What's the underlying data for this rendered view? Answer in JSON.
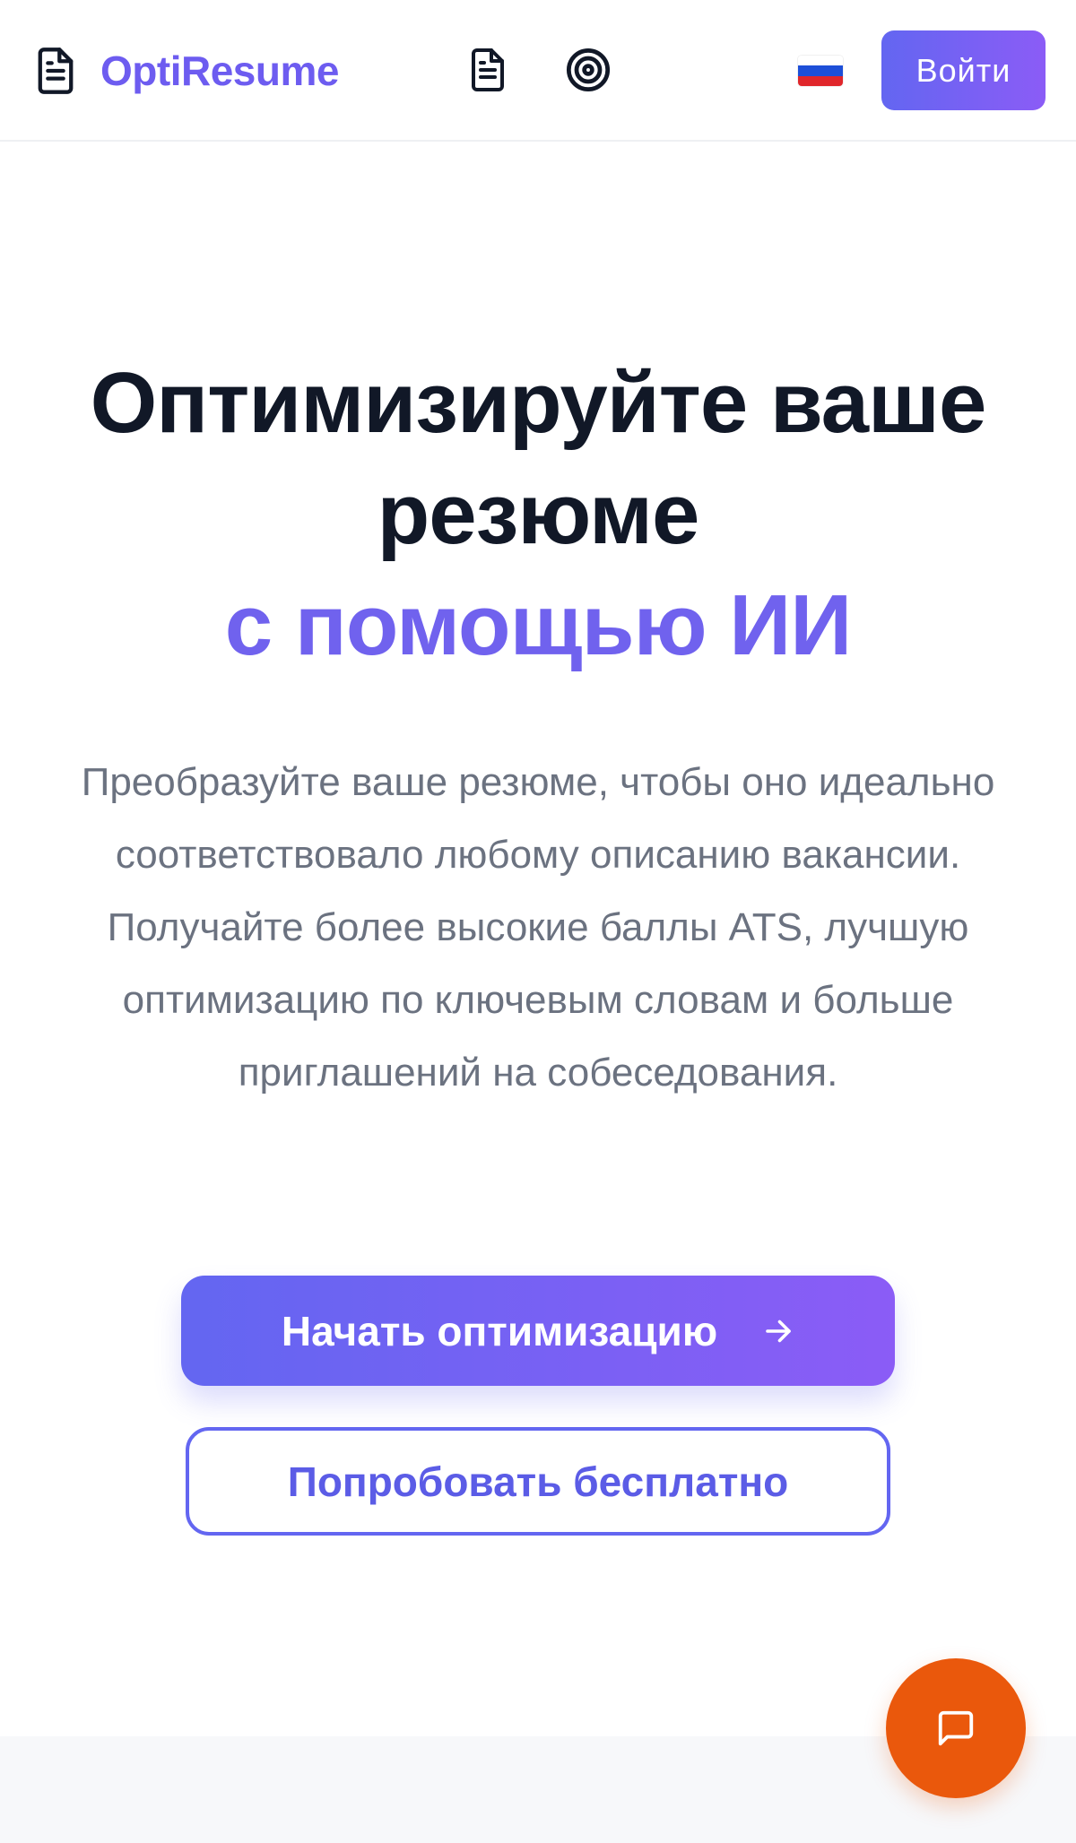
{
  "header": {
    "brand_name": "OptiResume",
    "brand_icon": "document-icon",
    "nav_icons": [
      "document-icon",
      "target-icon"
    ],
    "language_flag": "russia-flag-icon",
    "login_label": "Войти"
  },
  "hero": {
    "title_line1": "Оптимизируйте ваше",
    "title_line2": "резюме",
    "title_accent": "с помощью ИИ",
    "subtitle": "Преобразуйте ваше резюме, чтобы оно идеально соответствовало любому описанию вакансии. Получайте более высокие баллы ATS, лучшую оптимизацию по ключевым словам и больше приглашений на собеседования.",
    "primary_label": "Начать оптимизацию",
    "primary_icon": "arrow-right-icon",
    "secondary_label": "Попробовать бесплатно"
  },
  "chat": {
    "icon": "chat-bubble-icon"
  },
  "colors": {
    "accent": "#6d5cf0",
    "gradient_start": "#6366f1",
    "gradient_end": "#8b5cf6",
    "heading": "#111827",
    "body_text": "#6b7280",
    "chat_button": "#ea580c"
  }
}
